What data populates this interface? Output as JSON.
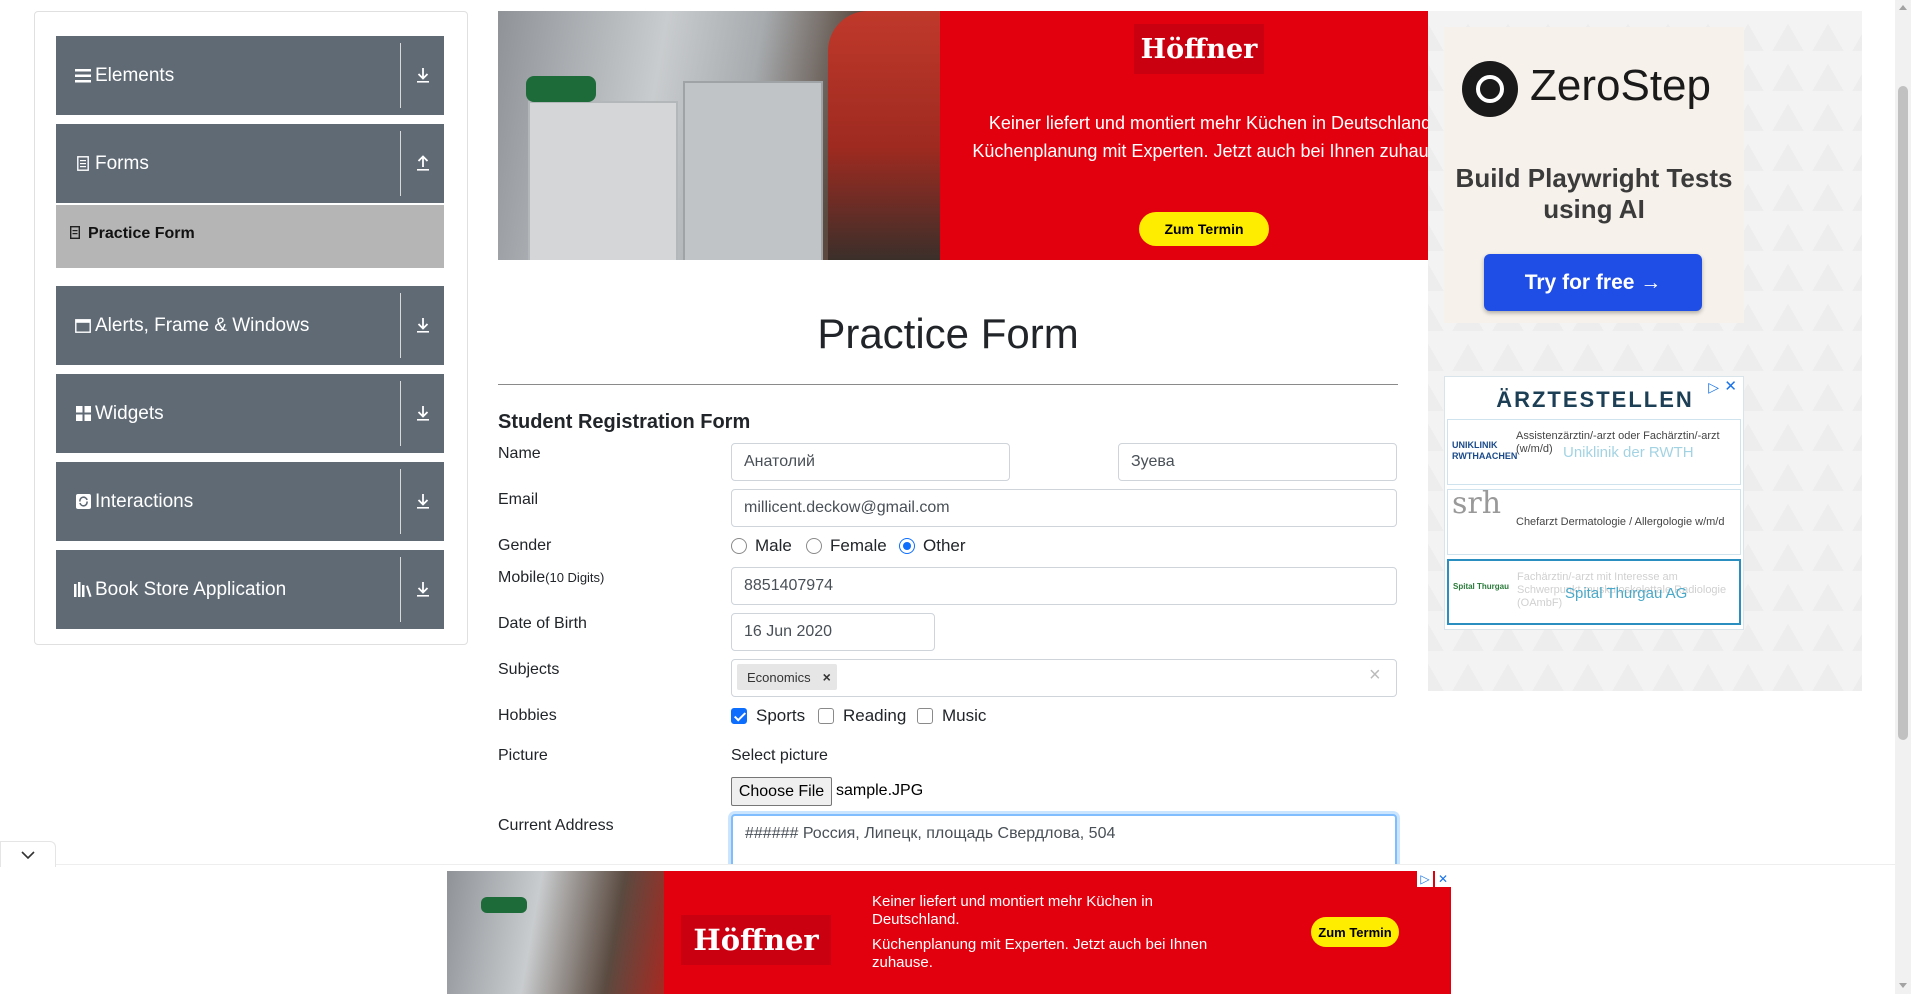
{
  "sidebar": {
    "groups": [
      {
        "label": "Elements",
        "icon": "hamburger-icon"
      },
      {
        "label": "Forms",
        "icon": "document-icon"
      },
      {
        "label": "Alerts, Frame & Windows",
        "icon": "window-icon"
      },
      {
        "label": "Widgets",
        "icon": "grid-icon"
      },
      {
        "label": "Interactions",
        "icon": "refresh-icon"
      },
      {
        "label": "Book Store Application",
        "icon": "books-icon"
      }
    ],
    "active_item": "Practice Form",
    "group_color": "#5f6a75",
    "active_color": "#b5b5b5"
  },
  "top_ad": {
    "brand": "Höffner",
    "line1": "Keiner liefert und montiert mehr Küchen in Deutschland",
    "line2": "Küchenplanung mit Experten. Jetzt auch bei Ihnen zuhause",
    "cta": "Zum Termin",
    "brand_color": "#e2000f"
  },
  "zerostep_ad": {
    "name": "ZeroStep",
    "tagline": "Build Playwright Tests using AI",
    "cta": "Try for free →",
    "cta_color": "#1f4ee6"
  },
  "aerzte_ad": {
    "brand": "ÄRZTESTELLEN",
    "adchoice": "▷",
    "close": "✕",
    "jobs": [
      {
        "logo": "UNIKLINIK RWTHAACHEN",
        "text": "Assistenzärztin/-arzt oder Fachärztin/-arzt (w/m/d)",
        "overlay": "Uniklinik der RWTH"
      },
      {
        "logo": "srh",
        "text": "Chefarzt Dermatologie / Allergologie w/m/d",
        "overlay": ""
      },
      {
        "logo": "Spital Thurgau",
        "text": "Fachärztin/-arzt mit Interesse am Schwerpunkt muskuloskelettale Radiologie (OAmbF)",
        "overlay": "Spital Thurgau AG"
      }
    ]
  },
  "form": {
    "title": "Practice Form",
    "heading": "Student Registration Form",
    "labels": {
      "name": "Name",
      "email": "Email",
      "gender": "Gender",
      "mobile": "Mobile",
      "mobile_hint": "(10 Digits)",
      "dob": "Date of Birth",
      "subjects": "Subjects",
      "hobbies": "Hobbies",
      "picture": "Picture",
      "address": "Current Address"
    },
    "first_name": "Анатолий",
    "last_name": "Зуева",
    "email": "millicent.deckow@gmail.com",
    "gender_options": [
      "Male",
      "Female",
      "Other"
    ],
    "gender_selected": "Other",
    "mobile": "8851407974",
    "dob": "16 Jun 2020",
    "subjects": [
      "Economics"
    ],
    "subject_remove": "×",
    "subjects_clear": "×",
    "hobbies": [
      {
        "label": "Sports",
        "checked": true
      },
      {
        "label": "Reading",
        "checked": false
      },
      {
        "label": "Music",
        "checked": false
      }
    ],
    "picture_label": "Select picture",
    "choose_file": "Choose File",
    "file_name": "sample.JPG",
    "address": "###### Россия, Липецк, площадь Свердлова, 504",
    "accent_color": "#0d6efd"
  },
  "bottom_ad": {
    "brand": "Höffner",
    "line1": "Keiner liefert und montiert mehr Küchen in Deutschland.",
    "line2": "Küchenplanung mit Experten. Jetzt auch bei Ihnen zuhause.",
    "cta": "Zum Termin",
    "adchoice": "▷",
    "close": "✕"
  },
  "collapse_icon": "chevron-down-icon"
}
